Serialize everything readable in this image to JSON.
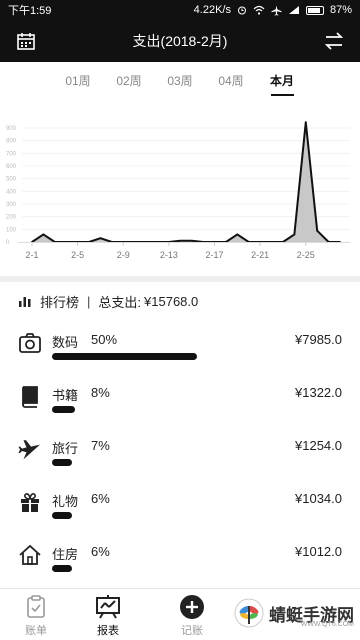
{
  "status_bar": {
    "time": "下午1:59",
    "speed": "4.22K/s",
    "battery": "87%"
  },
  "header": {
    "title": "支出(2018-2月)",
    "calendar_icon": "calendar-icon",
    "switch_icon": "switch-arrows-icon"
  },
  "tabs": [
    {
      "label": "01周",
      "active": false
    },
    {
      "label": "02周",
      "active": false
    },
    {
      "label": "03周",
      "active": false
    },
    {
      "label": "04周",
      "active": false
    },
    {
      "label": "本月",
      "active": true
    }
  ],
  "chart_data": {
    "type": "area",
    "y_ticks": [
      "900",
      "800",
      "700",
      "600",
      "500",
      "400",
      "300",
      "200",
      "100",
      "0"
    ],
    "x_tick_labels": [
      "2-1",
      "2-5",
      "2-9",
      "2-13",
      "2-17",
      "2-21",
      "2-25"
    ],
    "x_days": [
      1,
      2,
      3,
      4,
      5,
      6,
      7,
      8,
      9,
      10,
      11,
      12,
      13,
      14,
      15,
      16,
      17,
      18,
      19,
      20,
      21,
      22,
      23,
      24,
      25,
      26,
      27,
      28
    ],
    "values": [
      0,
      60,
      0,
      0,
      0,
      0,
      30,
      0,
      0,
      0,
      0,
      0,
      0,
      10,
      10,
      0,
      0,
      0,
      60,
      0,
      0,
      0,
      0,
      60,
      950,
      90,
      0,
      0
    ],
    "ylim": [
      0,
      1000
    ],
    "grid": true
  },
  "summary": {
    "rank_label": "排行榜",
    "separator": "|",
    "total_label": "总支出:",
    "total_value": "¥15768.0"
  },
  "ranking": [
    {
      "name": "数码",
      "percent": "50%",
      "amount": "¥7985.0",
      "share": 0.5,
      "icon": "camera-icon"
    },
    {
      "name": "书籍",
      "percent": "8%",
      "amount": "¥1322.0",
      "share": 0.08,
      "icon": "book-icon"
    },
    {
      "name": "旅行",
      "percent": "7%",
      "amount": "¥1254.0",
      "share": 0.07,
      "icon": "airplane-icon"
    },
    {
      "name": "礼物",
      "percent": "6%",
      "amount": "¥1034.0",
      "share": 0.06,
      "icon": "gift-icon"
    },
    {
      "name": "住房",
      "percent": "6%",
      "amount": "¥1012.0",
      "share": 0.06,
      "icon": "house-icon"
    }
  ],
  "bottom_nav": [
    {
      "label": "账单",
      "icon": "bill-icon",
      "active": false
    },
    {
      "label": "报表",
      "icon": "report-icon",
      "active": true
    },
    {
      "label": "记账",
      "icon": "plus-circle-icon",
      "active": false
    }
  ],
  "watermark": {
    "text": "蜻蜓手游网",
    "url": "WWW.QT6.COM"
  }
}
